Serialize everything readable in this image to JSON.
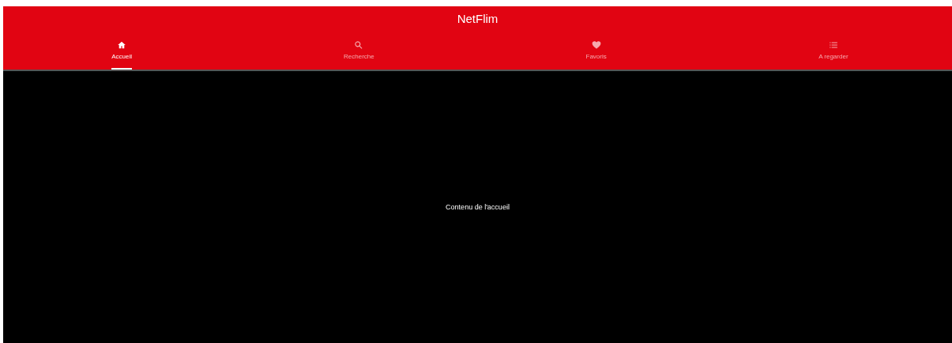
{
  "app_bar": {
    "title": "NetFlim"
  },
  "tabs": [
    {
      "label": "Accueil",
      "kind": "home",
      "selected": true
    },
    {
      "label": "Recherche",
      "kind": "search",
      "selected": false
    },
    {
      "label": "Favoris",
      "kind": "heart",
      "selected": false
    },
    {
      "label": "A regarder",
      "kind": "list",
      "selected": false
    }
  ],
  "content": {
    "text": "Contenu de l'accueil"
  }
}
